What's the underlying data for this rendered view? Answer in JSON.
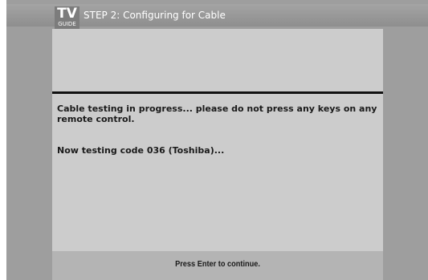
{
  "header": {
    "logo_tv": "TV",
    "logo_guide": "GUIDE",
    "title": "STEP 2: Configuring for Cable"
  },
  "main": {
    "message": "Cable testing in progress...  please do not press any keys on any remote control.",
    "status": "Now testing code 036 (Toshiba)..."
  },
  "footer": {
    "hint": "Press Enter to continue."
  },
  "colors": {
    "screen_background": "#9e9e9e",
    "panel_background": "#cccccc",
    "footer_background": "#b4b4b4",
    "divider": "#111111",
    "title_text": "#ffffff"
  }
}
